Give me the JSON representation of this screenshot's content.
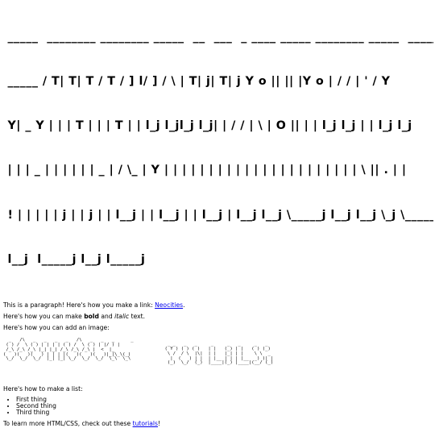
{
  "banner": {
    "lines": [
      " _____  ________ ________ _____  __  ___  _ ____ _____ ________ _____  ________",
      " _____ / T| T| T / T / ] l/ ] / \\ | T| j| T| j Y o || || |Y o | / / | ' / Y",
      " Y| _ Y | | | T | | | T | | l_j l_jl_j l_j| | / / | \\ | O || | | l_j l_j | | l_j l_j",
      " | | | _ | | | | | | _ | / \\_ | Y | | | | | | | | | | | | | | | | | | | | | | \\ || . | |",
      " ! | | | | | j | | j | | l__j | | l__j | | l__j | l__j l__j \\_____j l__j l__j \\_j \\_____/ l__j l__j",
      " l__j  l_____j l__j l_____j"
    ]
  },
  "para1": {
    "before": "This is a paragraph! Here's how you make a link: ",
    "link_text": "Neocities",
    "after": "."
  },
  "para2": {
    "before": "Here's how you can make ",
    "bold": "bold",
    "middle": " and ",
    "italic": "italic",
    "after": " text."
  },
  "para3": {
    "text": "Here's how you can add an image:"
  },
  "image_art": {
    "left": "  _   /\\   _   _   _   _   /\\   _   _   _      _\n ( ) /  \\ ( ) | | | | ( ) /  \\ ( ) | |/ ) |      \n /_\\ /_\\ /_\\ |_| |_| /_\\ /_\\ /_\\ |  <  |_      \n(   )(   )(   ) | | | |(   )(   )(   )|_|\\_\\(_)    \n \\_/  \\_/  \\_/  |_| |_| \\_/  \\_/  \\_/  \\_\\  \\_\\     ",
    "right": "  _ _   _   _     _     _   _     _   _   \n ( Y ) ( ) ( )   | |   (_) | |   ( ) (_)  \n  \\ /  / \\  |\\|  | |   |_| | |    \\ \\  _  \n   |  (   ) | |  | |__ | | | |__  _) )| | \n  (_)  \\_/  (_)  |____|(_) |____|(__/ (_) "
  },
  "para4": {
    "text": "Here's how to make a list:"
  },
  "list": {
    "items": [
      "First thing",
      "Second thing",
      "Third thing"
    ]
  },
  "para5": {
    "before": "To learn more HTML/CSS, check out these ",
    "link_text": "tutorials",
    "after": "!"
  }
}
